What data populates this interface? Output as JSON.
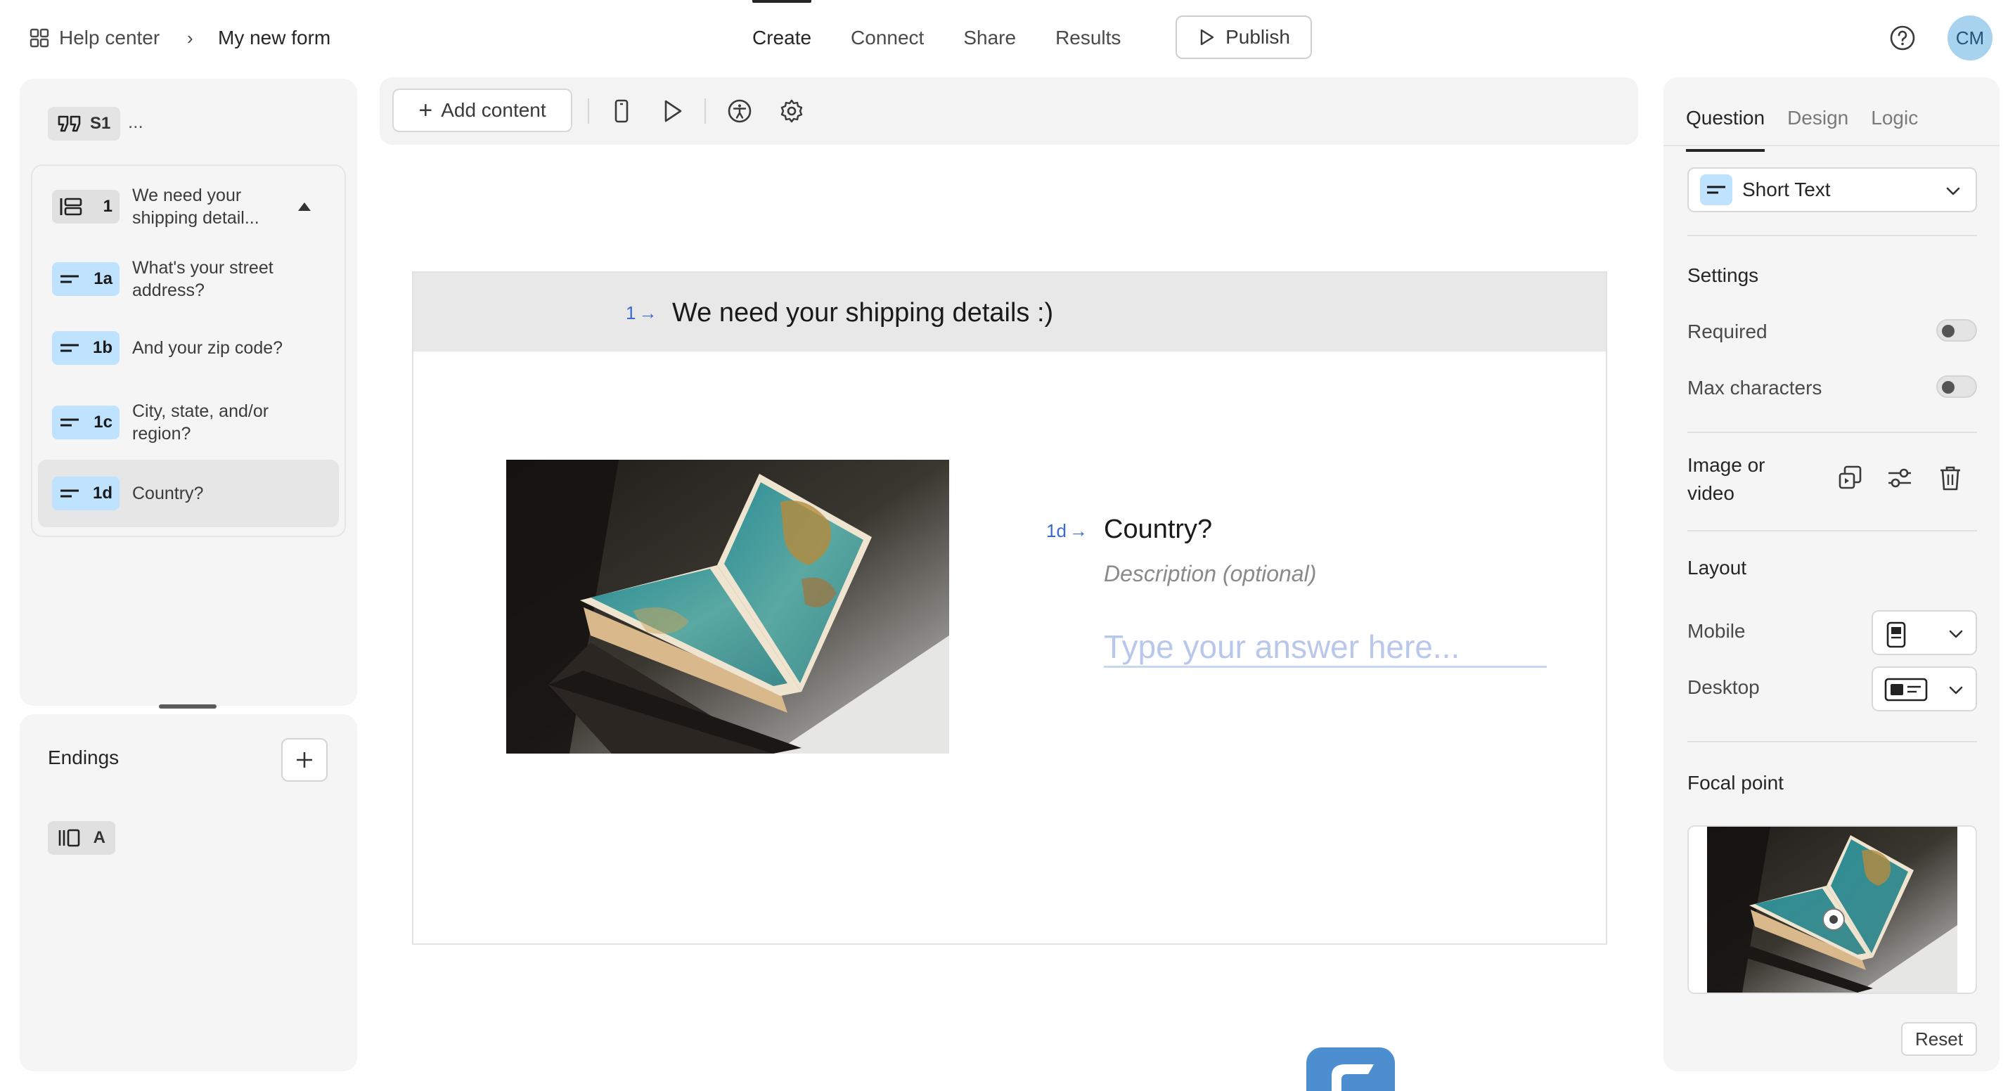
{
  "header": {
    "breadcrumb_home": "Help center",
    "breadcrumb_separator": "›",
    "form_name": "My new form",
    "nav_tabs": [
      "Create",
      "Connect",
      "Share",
      "Results"
    ],
    "active_tab": "Create",
    "publish_label": "Publish",
    "avatar_initials": "CM"
  },
  "left_panel": {
    "welcome_badge": "S1",
    "welcome_more": "...",
    "group": {
      "number": "1",
      "label": "We need your shipping detail..."
    },
    "questions": [
      {
        "number": "1a",
        "label": "What's your street address?"
      },
      {
        "number": "1b",
        "label": "And your zip code?"
      },
      {
        "number": "1c",
        "label": "City, state, and/or region?"
      },
      {
        "number": "1d",
        "label": "Country?"
      }
    ],
    "selected_question": "1d",
    "endings_title": "Endings",
    "endings_add": "+",
    "ending_badge": "A"
  },
  "toolbar": {
    "add_content_label": "Add content",
    "add_content_plus": "+"
  },
  "preview": {
    "group_number": "1",
    "group_arrow": "→",
    "group_title": "We need your shipping details :)",
    "question_number": "1d",
    "question_arrow": "→",
    "question_title": "Country?",
    "description": "Description (optional)",
    "answer_placeholder": "Type your answer here..."
  },
  "right_panel": {
    "tabs": [
      "Question",
      "Design",
      "Logic"
    ],
    "active_tab": "Question",
    "question_type": "Short Text",
    "settings_heading": "Settings",
    "required_label": "Required",
    "required_on": false,
    "max_characters_label": "Max characters",
    "max_characters_on": false,
    "image_or_video_label": "Image or video",
    "layout_heading": "Layout",
    "mobile_label": "Mobile",
    "desktop_label": "Desktop",
    "focal_point_heading": "Focal point",
    "reset_label": "Reset"
  },
  "colors": {
    "accent_blue": "#3a6bd1",
    "short_text_badge": "#bfe2ff",
    "avatar_bg": "#a8d3ee",
    "panel_bg": "#f5f5f5"
  }
}
